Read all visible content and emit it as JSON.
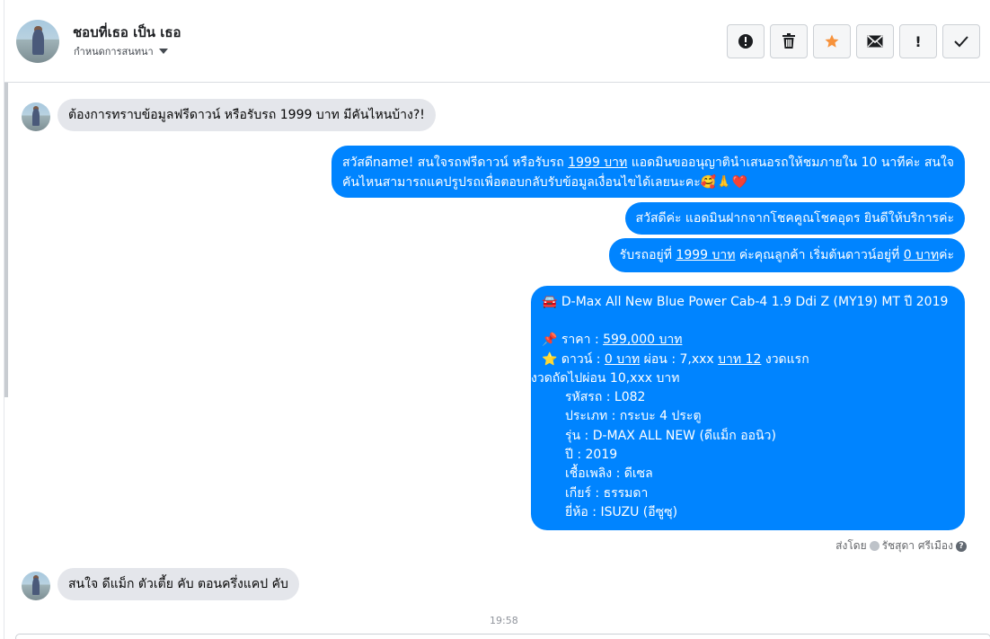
{
  "header": {
    "name": "ชอบที่เธอ เป็น เธอ",
    "subtitle": "กำหนดการสนทนา"
  },
  "toolbar": [
    {
      "name": "report-icon"
    },
    {
      "name": "trash-icon"
    },
    {
      "name": "star-icon",
      "color": "#f7923b"
    },
    {
      "name": "mail-icon"
    },
    {
      "name": "exclamation-icon",
      "label": "!"
    },
    {
      "name": "check-icon"
    }
  ],
  "messages": {
    "in1": "ต้องการทราบข้อมูลฟรีดาวน์ หรือรับรถ 1999 บาท มีคันไหนบ้าง?!",
    "out1": {
      "line1_a": "สวัสดีname! สนใจรถฟรีดาวน์ หรือรับรถ ",
      "line1_link": "1999 บาท",
      "line1_b": " แอดมินขออนุญาตินำเสนอรถให้ชมภายใน 10 นาทีค่ะ สนใจ",
      "line2": "คันไหนสามารถแคปรูปรถเพื่อตอบกลับรับข้อมูลเงื่อนไขได้เลยนะคะ🥰🙏❤️"
    },
    "out2": "สวัสดีค่ะ แอดมินฝากจากโชคคูณโชคอุดร ยินดีให้บริการค่ะ",
    "out3": {
      "a": "รับรถอยู่ที่ ",
      "link1": "1999 บาท",
      "b": " ค่ะคุณลูกค้า  เริ่มต้นดาวน์อยู่ที่ ",
      "link2": "0 บาท",
      "c": "ค่ะ"
    },
    "out4": {
      "title": "🚘 D-Max All New Blue Power Cab-4 1.9 Ddi Z (MY19) MT ปี 2019",
      "price_label": "📌 ราคา : ",
      "price_value": "599,000 บาท",
      "down_label": "⭐ ดาวน์ : ",
      "down_value": "0 บาท",
      "installment": " ผ่อน : 7,xxx ",
      "installment_link": "บาท 12",
      "installment_tail": " งวดแรก",
      "next": "งวดถัดไปผ่อน 10,xxx บาท",
      "code": "รหัสรถ : L082",
      "type": "ประเภท : กระบะ 4 ประตู",
      "model": "รุ่น : D-MAX ALL NEW (ดีแม็ก ออนิว)",
      "year": "ปี : 2019",
      "fuel": "เชื้อเพลิง : ดีเซล",
      "gear": "เกียร์ : ธรรมดา",
      "brand": "ยี่ห้อ : ISUZU (อีซูซุ)"
    },
    "sent_by_label": "ส่งโดย",
    "sent_by_name": "รัชสุดา ศรีเมือง",
    "in2": "สนใจ ดีแม็ก ตัวเตี้ย คับ ตอนครึ่งแคป คับ",
    "timestamp": "19:58"
  }
}
